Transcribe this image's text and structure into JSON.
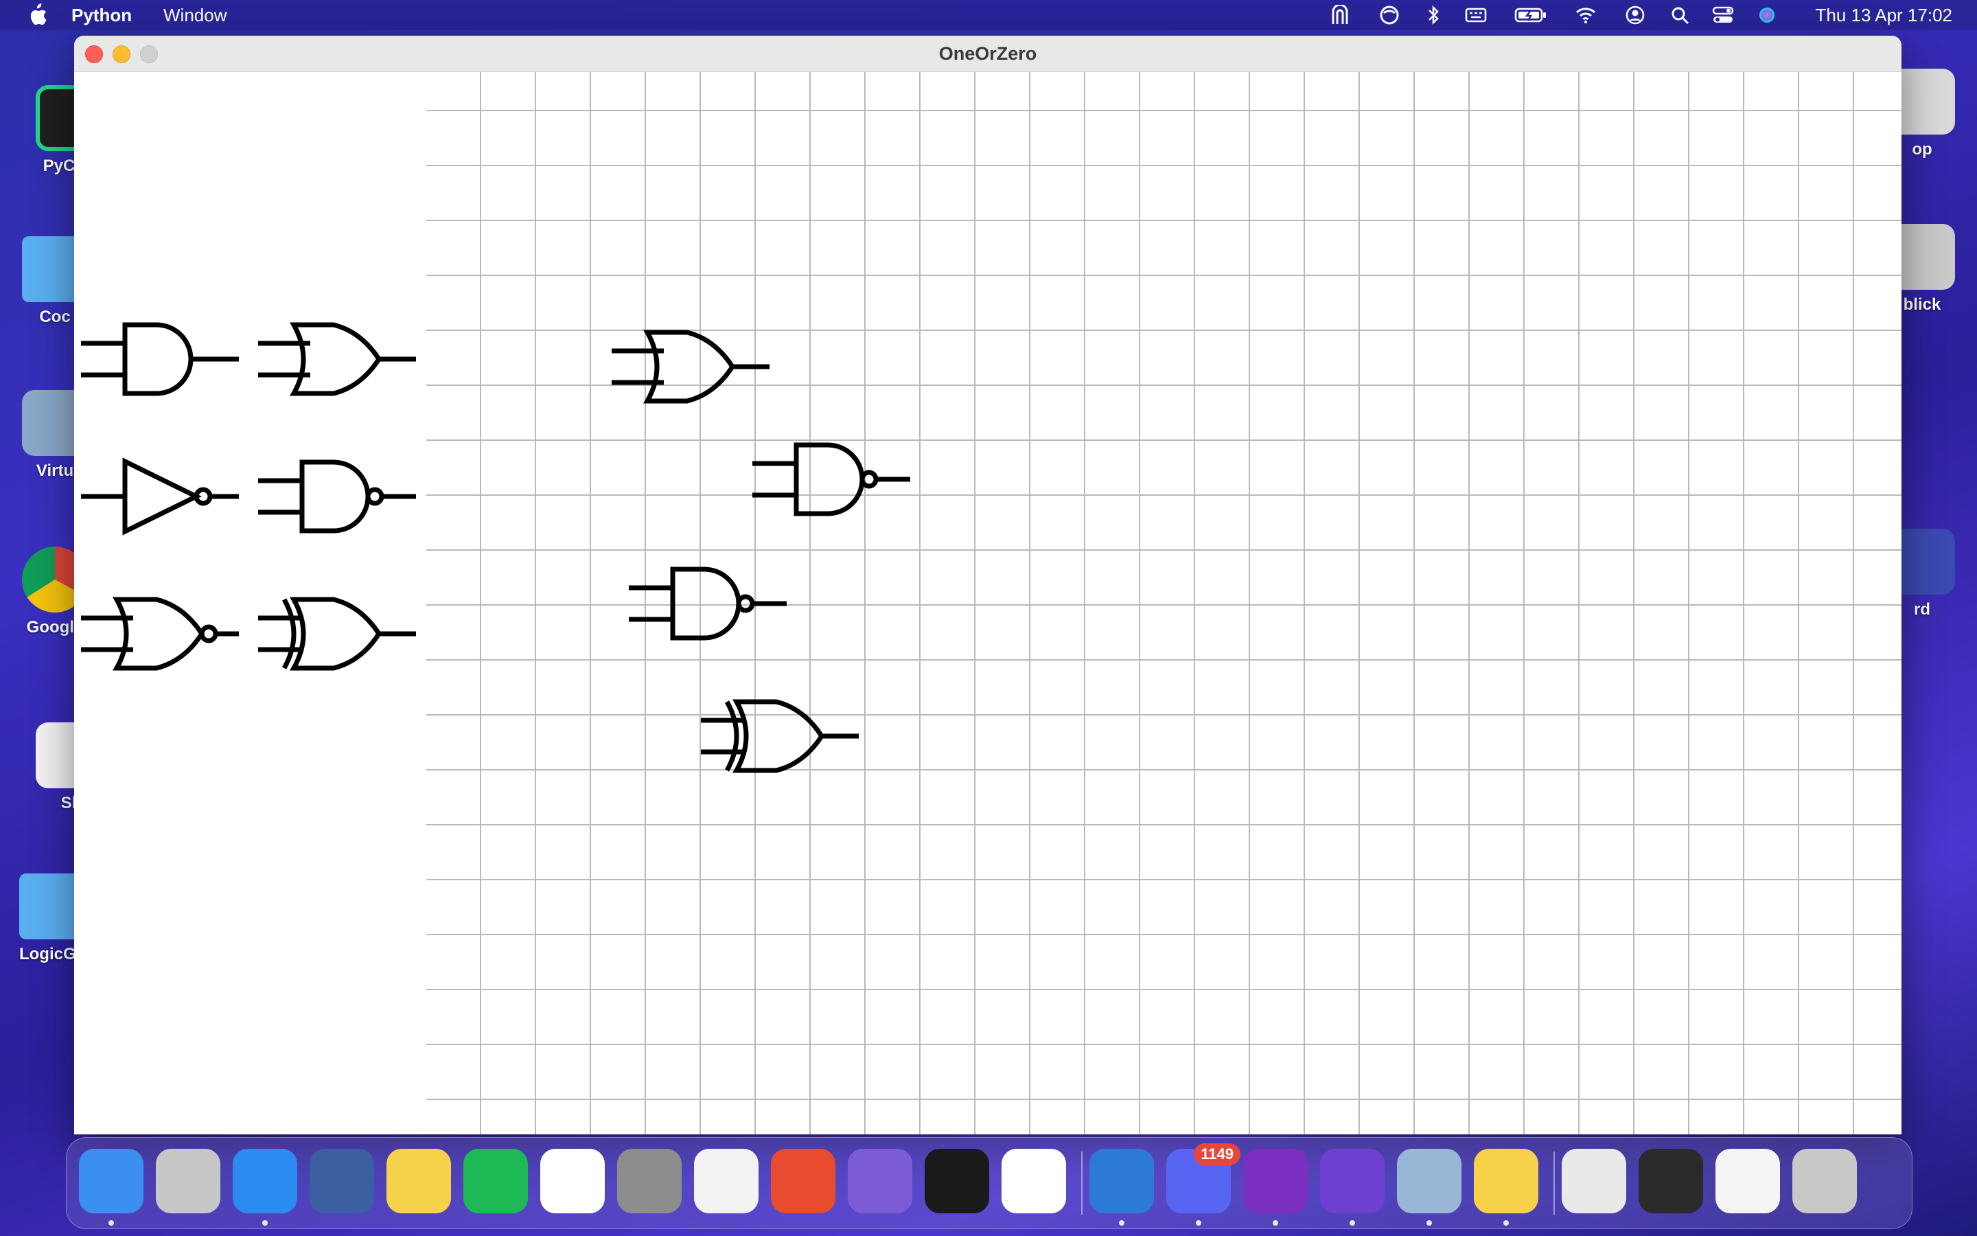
{
  "menubar": {
    "app_name": "Python",
    "menu_window": "Window",
    "clock": "Thu 13 Apr  17:02",
    "status_icons": [
      "elgato-icon",
      "sync-icon",
      "bluetooth-icon",
      "keyboard-icon",
      "battery-icon",
      "wifi-icon",
      "user-icon",
      "search-icon",
      "control-center-icon",
      "siri-icon"
    ]
  },
  "desktop": {
    "icons": [
      {
        "label": "PyCha",
        "icon": "pycharm-icon",
        "color": "#1f9f4f"
      },
      {
        "label": "Coc",
        "icon": "folder-icon",
        "color": "#5aaef0"
      },
      {
        "label": "Virtu",
        "icon": "virtualbox-icon",
        "color": "#8aa7c9"
      },
      {
        "label": "Google",
        "icon": "chrome-icon",
        "color": "#e8e8e8"
      },
      {
        "label": "Sl",
        "icon": "slack-icon",
        "color": "#f2f2f2"
      },
      {
        "label": "LogicGa",
        "icon": "folder-icon",
        "color": "#5aaef0"
      },
      {
        "label": "op",
        "icon": "app-icon",
        "color": "#d9d9d9"
      },
      {
        "label": "blick",
        "icon": "app-icon",
        "color": "#c9c9c9"
      },
      {
        "label": "rd",
        "icon": "app-icon",
        "color": "#3a4ab0"
      }
    ]
  },
  "window": {
    "title": "OneOrZero",
    "palette_gates": [
      "and-gate",
      "or-gate",
      "not-gate",
      "nand-gate",
      "nor-gate",
      "xor-gate"
    ],
    "canvas_gates": [
      "or-gate",
      "nand-gate",
      "nand-gate",
      "xor-gate"
    ]
  },
  "dock": {
    "apps": [
      {
        "name": "finder-icon",
        "color": "#3a8ff0"
      },
      {
        "name": "launchpad-icon",
        "color": "#c7c7c7"
      },
      {
        "name": "safari-icon",
        "color": "#2a8cf0"
      },
      {
        "name": "macos-installer-icon",
        "color": "#3b5fa0"
      },
      {
        "name": "notes-icon",
        "color": "#f6d24a"
      },
      {
        "name": "spotify-icon",
        "color": "#1db954"
      },
      {
        "name": "slack-icon",
        "color": "#ffffff"
      },
      {
        "name": "system-settings-icon",
        "color": "#8d8d8d"
      },
      {
        "name": "chrome-icon",
        "color": "#f2f2f2"
      },
      {
        "name": "anydesk-icon",
        "color": "#e84b2e"
      },
      {
        "name": "obsidian-icon",
        "color": "#7c5cd6"
      },
      {
        "name": "activity-monitor-icon",
        "color": "#1a1a1a"
      },
      {
        "name": "orbit-icon",
        "color": "#ffffff"
      },
      {
        "name": "vscode-icon",
        "color": "#2c7ad6"
      },
      {
        "name": "discord-icon",
        "color": "#5865f2"
      },
      {
        "name": "onenote-icon",
        "color": "#7b2fc1"
      },
      {
        "name": "github-icon",
        "color": "#6e3fd1"
      },
      {
        "name": "preview-icon",
        "color": "#9ab6d6"
      },
      {
        "name": "cyberduck-icon",
        "color": "#f6d24a"
      },
      {
        "name": "document-thumbnail-icon",
        "color": "#e9e9e9"
      },
      {
        "name": "window-thumbnail-icon",
        "color": "#2a2a2a"
      },
      {
        "name": "document-thumbnail-icon",
        "color": "#f4f4f4"
      },
      {
        "name": "trash-icon",
        "color": "#c8c8c8"
      }
    ],
    "discord_badge": "1149"
  }
}
